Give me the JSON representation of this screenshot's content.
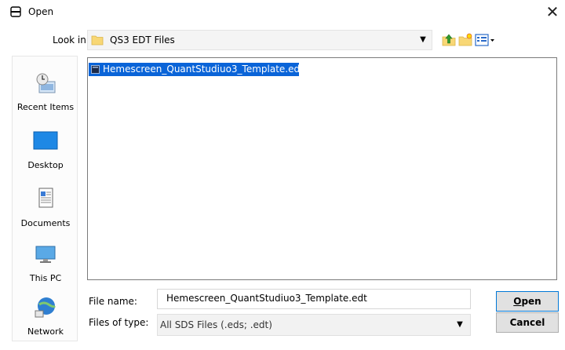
{
  "window": {
    "title": "Open"
  },
  "look_in": {
    "label": "Look in:",
    "value": "QS3 EDT Files"
  },
  "toolbar": {
    "up_icon": "up-folder-icon",
    "new_folder_icon": "new-folder-icon",
    "view_menu_icon": "view-menu-icon"
  },
  "places": [
    {
      "label": "Recent Items",
      "icon": "recent-items-icon"
    },
    {
      "label": "Desktop",
      "icon": "desktop-icon"
    },
    {
      "label": "Documents",
      "icon": "documents-icon"
    },
    {
      "label": "This PC",
      "icon": "this-pc-icon"
    },
    {
      "label": "Network",
      "icon": "network-icon"
    }
  ],
  "files": [
    {
      "name": "Hemescreen_QuantStudiuo3_Template.edt",
      "selected": true
    }
  ],
  "file_name": {
    "label": "File name:",
    "value": "Hemescreen_QuantStudiuo3_Template.edt"
  },
  "file_type": {
    "label": "Files of type:",
    "value": "All SDS Files (.eds; .edt)"
  },
  "buttons": {
    "open_underlined": "O",
    "open_rest": "pen",
    "cancel": "Cancel"
  },
  "colors": {
    "selection": "#0a64d8",
    "folder": "#f8d775",
    "accent": "#0078d7"
  }
}
